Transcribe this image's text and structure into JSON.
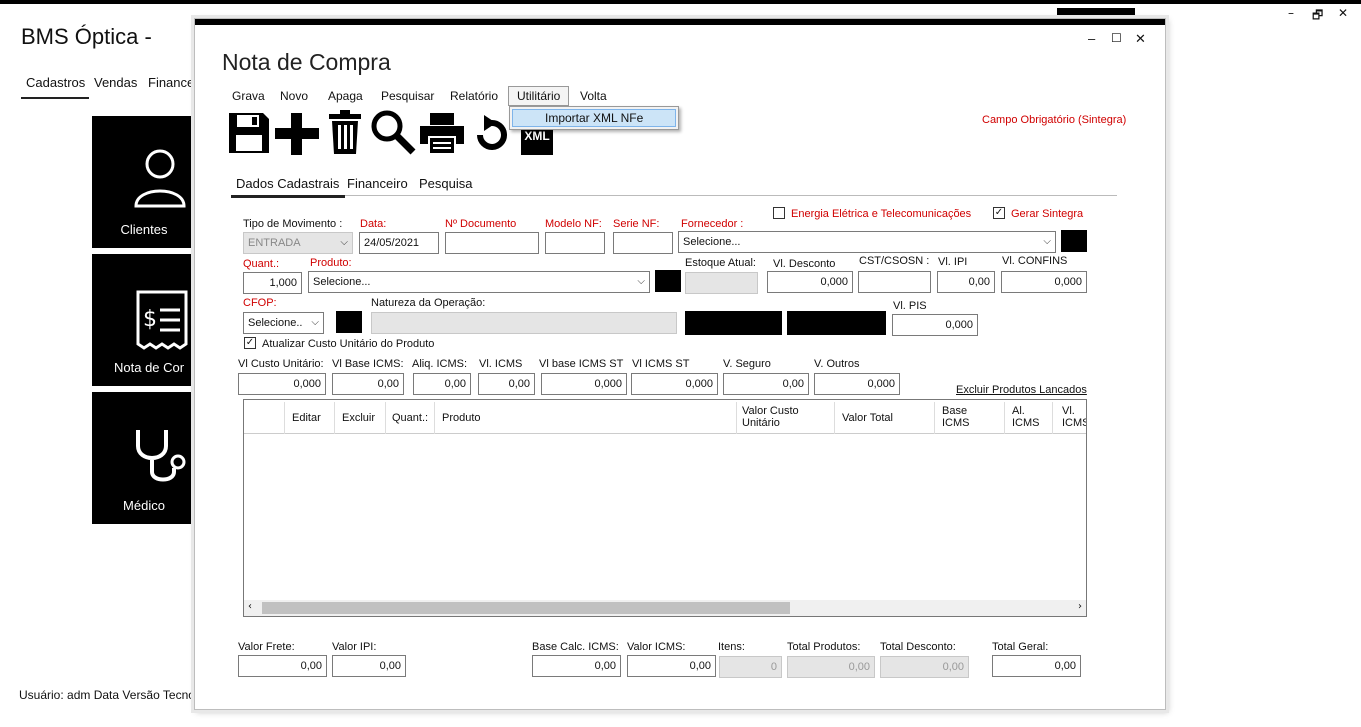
{
  "app": {
    "title": "BMS Óptica -",
    "menu": [
      "Cadastros",
      "Vendas",
      "Financeiro"
    ],
    "tiles": [
      "Clientes",
      "Nota de Compra",
      "Médico"
    ],
    "status": {
      "user": "Usuário: adm",
      "data": "Data",
      "versao": "Versão Tecno"
    },
    "window_controls": [
      "–",
      "🗗",
      "✕"
    ]
  },
  "dialog": {
    "title": "Nota de Compra",
    "controls": [
      "–",
      "☐",
      "✕"
    ],
    "menu": [
      "Grava",
      "Novo",
      "Apaga",
      "Pesquisar",
      "Relatório",
      "Utilitário",
      "Volta"
    ],
    "dropdown_item": "Importar XML NFe",
    "xml_label": "XML",
    "required_note": "Campo Obrigatório (Sintegra)",
    "tabs": [
      "Dados Cadastrais",
      "Financeiro",
      "Pesquisa"
    ],
    "energia_label": "Energia Elétrica e  Telecomunicações",
    "gerar_sintegra": "Gerar Sintegra",
    "gerar_sintegra_checked": true,
    "fields": {
      "tipo_mov": {
        "label": "Tipo de Movimento :",
        "value": "ENTRADA"
      },
      "data": {
        "label": "Data:",
        "value": "24/05/2021"
      },
      "num_doc": {
        "label": "Nº Documento",
        "value": ""
      },
      "modelo_nf": {
        "label": "Modelo NF:",
        "value": ""
      },
      "serie_nf": {
        "label": "Serie NF:",
        "value": ""
      },
      "fornecedor": {
        "label": "Fornecedor :",
        "value": "Selecione..."
      },
      "quant": {
        "label": "Quant.:",
        "value": "1,000"
      },
      "produto": {
        "label": "Produto:",
        "value": "Selecione..."
      },
      "estoque": {
        "label": "Estoque Atual:",
        "value": ""
      },
      "vl_desconto": {
        "label": "Vl. Desconto",
        "value": "0,000"
      },
      "cst": {
        "label": "CST/CSOSN :",
        "value": ""
      },
      "vl_ipi": {
        "label": "Vl. IPI",
        "value": "0,00"
      },
      "vl_confins": {
        "label": "Vl. CONFINS",
        "value": "0,000"
      },
      "cfop": {
        "label": "CFOP:",
        "value": "Selecione.."
      },
      "natureza": {
        "label": "Natureza da Operação:",
        "value": ""
      },
      "vl_pis": {
        "label": "Vl. PIS",
        "value": "0,000"
      }
    },
    "atualizar_label": "Atualizar Custo Unitário do Produto",
    "atualizar_checked": true,
    "row3": [
      {
        "label": "Vl Custo Unitário:",
        "value": "0,000"
      },
      {
        "label": "Vl Base ICMS:",
        "value": "0,00"
      },
      {
        "label": "Aliq. ICMS:",
        "value": "0,00"
      },
      {
        "label": "Vl. ICMS",
        "value": "0,00"
      },
      {
        "label": "Vl base ICMS ST",
        "value": "0,000"
      },
      {
        "label": "Vl ICMS ST",
        "value": "0,000"
      },
      {
        "label": "V. Seguro",
        "value": "0,00"
      },
      {
        "label": "V. Outros",
        "value": "0,000"
      }
    ],
    "excluir_link": "Excluir Produtos Lancados",
    "table_headers": [
      "Editar",
      "Excluir",
      "Quant.:",
      "Produto",
      "Valor Custo Unitário",
      "Valor Total",
      "Base ICMS",
      "Al. ICMS",
      "Vl. ICMS"
    ],
    "footer": [
      {
        "label": "Valor Frete:",
        "value": "0,00"
      },
      {
        "label": "Valor IPI:",
        "value": "0,00"
      },
      {
        "label": "Base Calc. ICMS:",
        "value": "0,00"
      },
      {
        "label": "Valor ICMS:",
        "value": "0,00"
      },
      {
        "label": "Itens:",
        "value": "0"
      },
      {
        "label": "Total Produtos:",
        "value": "0,00"
      },
      {
        "label": "Total Desconto:",
        "value": "0,00"
      },
      {
        "label": "Total Geral:",
        "value": "0,00"
      }
    ]
  }
}
